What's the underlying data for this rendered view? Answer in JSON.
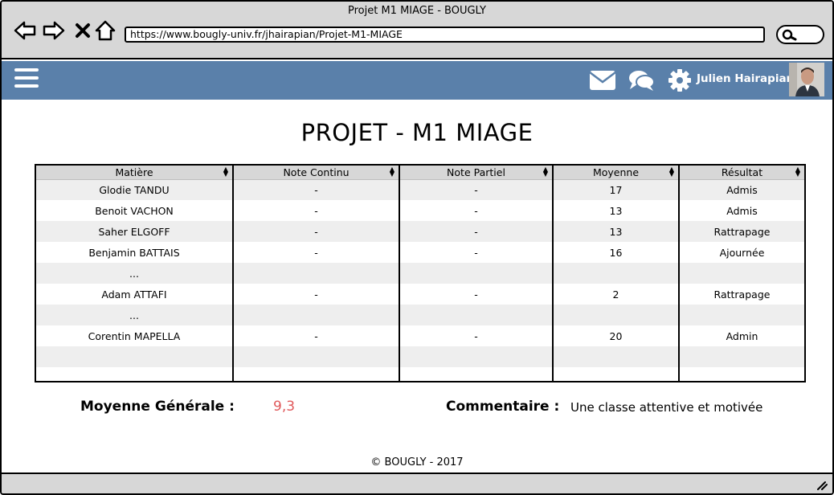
{
  "window": {
    "title": "Projet M1 MIAGE - BOUGLY",
    "url": "https://www.bougly-univ.fr/jhairapian/Projet-M1-MIAGE"
  },
  "header": {
    "user_name": "Julien Hairapian",
    "icons": [
      "menu-icon",
      "mail-icon",
      "chat-icon",
      "gear-icon"
    ],
    "bg_color": "#5a80aa"
  },
  "page": {
    "title": "PROJET - M1 MIAGE"
  },
  "table": {
    "columns": [
      "Matière",
      "Note Continu",
      "Note Partiel",
      "Moyenne",
      "Résultat"
    ],
    "rows": [
      [
        "Glodie TANDU",
        "-",
        "-",
        "17",
        "Admis"
      ],
      [
        "Benoit VACHON",
        "-",
        "-",
        "13",
        "Admis"
      ],
      [
        "Saher ELGOFF",
        "-",
        "-",
        "13",
        "Rattrapage"
      ],
      [
        "Benjamin BATTAIS",
        "-",
        "-",
        "16",
        "Ajournée"
      ],
      [
        "...",
        "",
        "",
        "",
        ""
      ],
      [
        "Adam ATTAFI",
        "-",
        "-",
        "2",
        "Rattrapage"
      ],
      [
        "...",
        "",
        "",
        "",
        ""
      ],
      [
        "Corentin MAPELLA",
        "-",
        "-",
        "20",
        "Admin"
      ]
    ]
  },
  "summary": {
    "average_label": "Moyenne Générale :",
    "average_value": "9,3",
    "comment_label": "Commentaire :",
    "comment_value": "Une classe attentive et motivée",
    "accent_color": "#e0585a"
  },
  "footer": {
    "text": "© BOUGLY - 2017"
  }
}
